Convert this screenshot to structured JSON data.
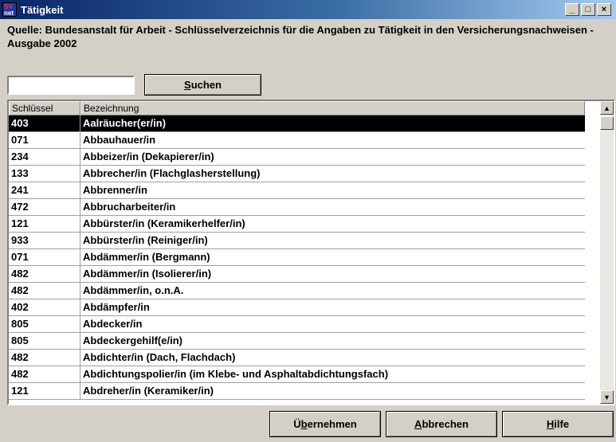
{
  "window": {
    "icon_text_top": "SV",
    "icon_text_bottom": "net",
    "title": "Tätigkeit",
    "minimize_glyph": "_",
    "maximize_glyph": "□",
    "close_glyph": "×"
  },
  "header": {
    "source_text": "Quelle: Bundesanstalt für Arbeit - Schlüsselverzeichnis für die Angaben zu Tätigkeit in den Versicherungsnachweisen - Ausgabe 2002"
  },
  "search": {
    "value": "",
    "button_mnemonic": "S",
    "button_rest": "uchen"
  },
  "table": {
    "columns": [
      "Schlüssel",
      "Bezeichnung"
    ],
    "selected_index": 0,
    "rows": [
      {
        "key": "403",
        "name": "Aalräucher(er/in)"
      },
      {
        "key": "071",
        "name": "Abbauhauer/in"
      },
      {
        "key": "234",
        "name": "Abbeizer/in (Dekapierer/in)"
      },
      {
        "key": "133",
        "name": "Abbrecher/in (Flachglasherstellung)"
      },
      {
        "key": "241",
        "name": "Abbrenner/in"
      },
      {
        "key": "472",
        "name": "Abbrucharbeiter/in"
      },
      {
        "key": "121",
        "name": "Abbürster/in (Keramikerhelfer/in)"
      },
      {
        "key": "933",
        "name": "Abbürster/in (Reiniger/in)"
      },
      {
        "key": "071",
        "name": "Abdämmer/in (Bergmann)"
      },
      {
        "key": "482",
        "name": "Abdämmer/in (Isolierer/in)"
      },
      {
        "key": "482",
        "name": "Abdämmer/in, o.n.A."
      },
      {
        "key": "402",
        "name": "Abdämpfer/in"
      },
      {
        "key": "805",
        "name": "Abdecker/in"
      },
      {
        "key": "805",
        "name": "Abdeckergehilf(e/in)"
      },
      {
        "key": "482",
        "name": "Abdichter/in (Dach, Flachdach)"
      },
      {
        "key": "482",
        "name": "Abdichtungspolier/in (im Klebe- und Asphaltabdichtungsfach)"
      },
      {
        "key": "121",
        "name": "Abdreher/in (Keramiker/in)"
      }
    ]
  },
  "scrollbar": {
    "up_glyph": "▲",
    "down_glyph": "▼"
  },
  "footer": {
    "ok_pre": "Ü",
    "ok_mnemonic": "b",
    "ok_rest": "ernehmen",
    "cancel_mnemonic": "A",
    "cancel_rest": "bbrechen",
    "help_mnemonic": "H",
    "help_rest": "ilfe"
  }
}
